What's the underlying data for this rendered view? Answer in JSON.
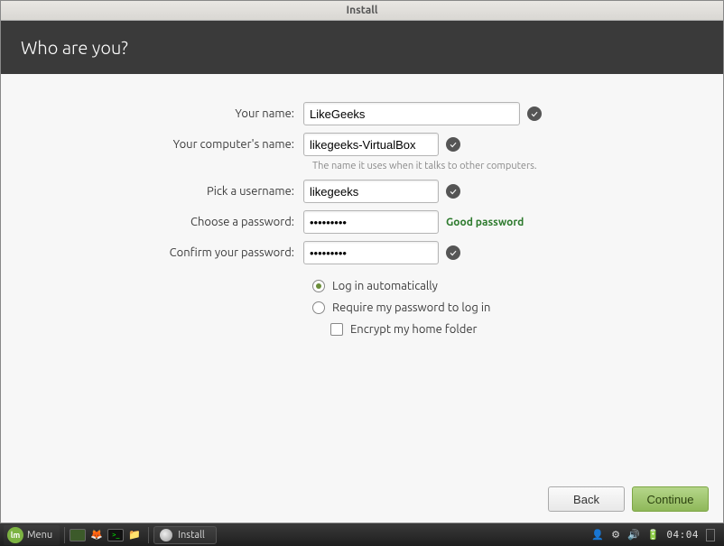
{
  "window": {
    "title": "Install"
  },
  "header": {
    "title": "Who are you?"
  },
  "labels": {
    "your_name": "Your name:",
    "computer_name": "Your computer's name:",
    "username": "Pick a username:",
    "password": "Choose a password:",
    "confirm": "Confirm your password:"
  },
  "values": {
    "your_name": "LikeGeeks",
    "computer_name": "likegeeks-VirtualBox",
    "username": "likegeeks",
    "password": "•••••••••",
    "confirm": "•••••••••"
  },
  "hints": {
    "computer_name": "The name it uses when it talks to other computers."
  },
  "password_strength": "Good password",
  "options": {
    "auto_login": "Log in automatically",
    "require_password": "Require my password to log in",
    "encrypt_home": "Encrypt my home folder"
  },
  "buttons": {
    "back": "Back",
    "continue": "Continue"
  },
  "taskbar": {
    "menu": "Menu",
    "active_task": "Install",
    "time": "04:04"
  }
}
